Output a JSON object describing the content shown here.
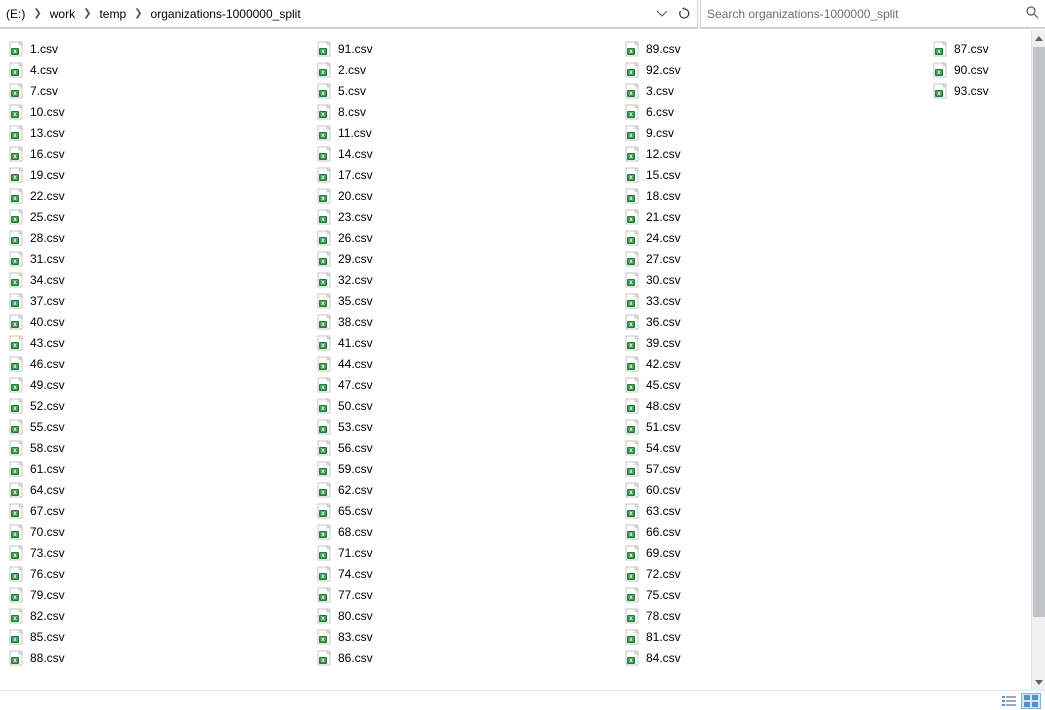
{
  "breadcrumb": {
    "drive": "(E:)",
    "parts": [
      "work",
      "temp",
      "organizations-1000000_split"
    ]
  },
  "search": {
    "placeholder": "Search organizations-1000000_split"
  },
  "files": [
    "1.csv",
    "2.csv",
    "3.csv",
    "4.csv",
    "5.csv",
    "6.csv",
    "7.csv",
    "8.csv",
    "9.csv",
    "10.csv",
    "11.csv",
    "12.csv",
    "13.csv",
    "14.csv",
    "15.csv",
    "16.csv",
    "17.csv",
    "18.csv",
    "19.csv",
    "20.csv",
    "21.csv",
    "22.csv",
    "23.csv",
    "24.csv",
    "25.csv",
    "26.csv",
    "27.csv",
    "28.csv",
    "29.csv",
    "30.csv",
    "31.csv",
    "32.csv",
    "33.csv",
    "34.csv",
    "35.csv",
    "36.csv",
    "37.csv",
    "38.csv",
    "39.csv",
    "40.csv",
    "41.csv",
    "42.csv",
    "43.csv",
    "44.csv",
    "45.csv",
    "46.csv",
    "47.csv",
    "48.csv",
    "49.csv",
    "50.csv",
    "51.csv",
    "52.csv",
    "53.csv",
    "54.csv",
    "55.csv",
    "56.csv",
    "57.csv",
    "58.csv",
    "59.csv",
    "60.csv",
    "61.csv",
    "62.csv",
    "63.csv",
    "64.csv",
    "65.csv",
    "66.csv",
    "67.csv",
    "68.csv",
    "69.csv",
    "70.csv",
    "71.csv",
    "72.csv",
    "73.csv",
    "74.csv",
    "75.csv",
    "76.csv",
    "77.csv",
    "78.csv",
    "79.csv",
    "80.csv",
    "81.csv",
    "82.csv",
    "83.csv",
    "84.csv",
    "85.csv",
    "86.csv",
    "87.csv",
    "88.csv",
    "89.csv",
    "90.csv",
    "91.csv",
    "92.csv",
    "93.csv"
  ],
  "columns": [
    [
      1,
      4,
      7,
      10,
      13,
      16,
      19,
      22,
      25,
      28,
      31,
      34,
      37,
      40,
      43,
      46,
      49,
      52,
      55,
      58,
      61,
      64,
      67,
      70,
      73,
      76,
      79,
      82,
      85,
      88,
      91
    ],
    [
      2,
      5,
      8,
      11,
      14,
      17,
      20,
      23,
      26,
      29,
      32,
      35,
      38,
      41,
      44,
      47,
      50,
      53,
      56,
      59,
      62,
      65,
      68,
      71,
      74,
      77,
      80,
      83,
      86,
      89,
      92
    ],
    [
      3,
      6,
      9,
      12,
      15,
      18,
      21,
      24,
      27,
      30,
      33,
      36,
      39,
      42,
      45,
      48,
      51,
      54,
      57,
      60,
      63,
      66,
      69,
      72,
      75,
      78,
      81,
      84,
      87,
      90,
      93
    ]
  ]
}
